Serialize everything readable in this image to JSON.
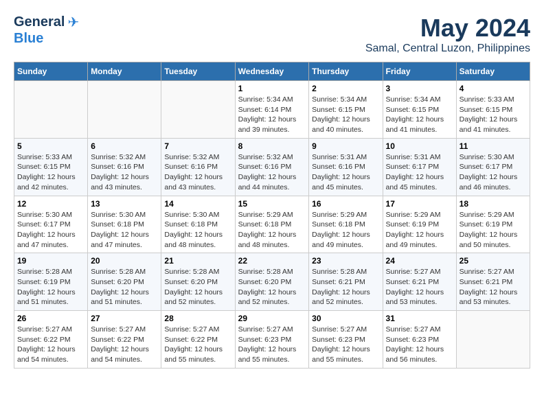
{
  "header": {
    "logo_line1": "General",
    "logo_line2": "Blue",
    "month": "May 2024",
    "location": "Samal, Central Luzon, Philippines"
  },
  "days_of_week": [
    "Sunday",
    "Monday",
    "Tuesday",
    "Wednesday",
    "Thursday",
    "Friday",
    "Saturday"
  ],
  "weeks": [
    [
      {
        "day": "",
        "info": ""
      },
      {
        "day": "",
        "info": ""
      },
      {
        "day": "",
        "info": ""
      },
      {
        "day": "1",
        "info": "Sunrise: 5:34 AM\nSunset: 6:14 PM\nDaylight: 12 hours\nand 39 minutes."
      },
      {
        "day": "2",
        "info": "Sunrise: 5:34 AM\nSunset: 6:15 PM\nDaylight: 12 hours\nand 40 minutes."
      },
      {
        "day": "3",
        "info": "Sunrise: 5:34 AM\nSunset: 6:15 PM\nDaylight: 12 hours\nand 41 minutes."
      },
      {
        "day": "4",
        "info": "Sunrise: 5:33 AM\nSunset: 6:15 PM\nDaylight: 12 hours\nand 41 minutes."
      }
    ],
    [
      {
        "day": "5",
        "info": "Sunrise: 5:33 AM\nSunset: 6:15 PM\nDaylight: 12 hours\nand 42 minutes."
      },
      {
        "day": "6",
        "info": "Sunrise: 5:32 AM\nSunset: 6:16 PM\nDaylight: 12 hours\nand 43 minutes."
      },
      {
        "day": "7",
        "info": "Sunrise: 5:32 AM\nSunset: 6:16 PM\nDaylight: 12 hours\nand 43 minutes."
      },
      {
        "day": "8",
        "info": "Sunrise: 5:32 AM\nSunset: 6:16 PM\nDaylight: 12 hours\nand 44 minutes."
      },
      {
        "day": "9",
        "info": "Sunrise: 5:31 AM\nSunset: 6:16 PM\nDaylight: 12 hours\nand 45 minutes."
      },
      {
        "day": "10",
        "info": "Sunrise: 5:31 AM\nSunset: 6:17 PM\nDaylight: 12 hours\nand 45 minutes."
      },
      {
        "day": "11",
        "info": "Sunrise: 5:30 AM\nSunset: 6:17 PM\nDaylight: 12 hours\nand 46 minutes."
      }
    ],
    [
      {
        "day": "12",
        "info": "Sunrise: 5:30 AM\nSunset: 6:17 PM\nDaylight: 12 hours\nand 47 minutes."
      },
      {
        "day": "13",
        "info": "Sunrise: 5:30 AM\nSunset: 6:18 PM\nDaylight: 12 hours\nand 47 minutes."
      },
      {
        "day": "14",
        "info": "Sunrise: 5:30 AM\nSunset: 6:18 PM\nDaylight: 12 hours\nand 48 minutes."
      },
      {
        "day": "15",
        "info": "Sunrise: 5:29 AM\nSunset: 6:18 PM\nDaylight: 12 hours\nand 48 minutes."
      },
      {
        "day": "16",
        "info": "Sunrise: 5:29 AM\nSunset: 6:18 PM\nDaylight: 12 hours\nand 49 minutes."
      },
      {
        "day": "17",
        "info": "Sunrise: 5:29 AM\nSunset: 6:19 PM\nDaylight: 12 hours\nand 49 minutes."
      },
      {
        "day": "18",
        "info": "Sunrise: 5:29 AM\nSunset: 6:19 PM\nDaylight: 12 hours\nand 50 minutes."
      }
    ],
    [
      {
        "day": "19",
        "info": "Sunrise: 5:28 AM\nSunset: 6:19 PM\nDaylight: 12 hours\nand 51 minutes."
      },
      {
        "day": "20",
        "info": "Sunrise: 5:28 AM\nSunset: 6:20 PM\nDaylight: 12 hours\nand 51 minutes."
      },
      {
        "day": "21",
        "info": "Sunrise: 5:28 AM\nSunset: 6:20 PM\nDaylight: 12 hours\nand 52 minutes."
      },
      {
        "day": "22",
        "info": "Sunrise: 5:28 AM\nSunset: 6:20 PM\nDaylight: 12 hours\nand 52 minutes."
      },
      {
        "day": "23",
        "info": "Sunrise: 5:28 AM\nSunset: 6:21 PM\nDaylight: 12 hours\nand 52 minutes."
      },
      {
        "day": "24",
        "info": "Sunrise: 5:27 AM\nSunset: 6:21 PM\nDaylight: 12 hours\nand 53 minutes."
      },
      {
        "day": "25",
        "info": "Sunrise: 5:27 AM\nSunset: 6:21 PM\nDaylight: 12 hours\nand 53 minutes."
      }
    ],
    [
      {
        "day": "26",
        "info": "Sunrise: 5:27 AM\nSunset: 6:22 PM\nDaylight: 12 hours\nand 54 minutes."
      },
      {
        "day": "27",
        "info": "Sunrise: 5:27 AM\nSunset: 6:22 PM\nDaylight: 12 hours\nand 54 minutes."
      },
      {
        "day": "28",
        "info": "Sunrise: 5:27 AM\nSunset: 6:22 PM\nDaylight: 12 hours\nand 55 minutes."
      },
      {
        "day": "29",
        "info": "Sunrise: 5:27 AM\nSunset: 6:23 PM\nDaylight: 12 hours\nand 55 minutes."
      },
      {
        "day": "30",
        "info": "Sunrise: 5:27 AM\nSunset: 6:23 PM\nDaylight: 12 hours\nand 55 minutes."
      },
      {
        "day": "31",
        "info": "Sunrise: 5:27 AM\nSunset: 6:23 PM\nDaylight: 12 hours\nand 56 minutes."
      },
      {
        "day": "",
        "info": ""
      }
    ]
  ]
}
